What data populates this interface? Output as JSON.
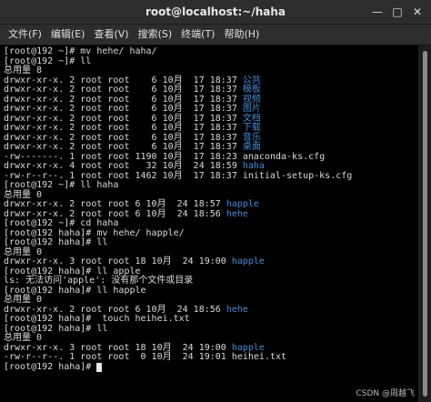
{
  "window": {
    "title": "root@localhost:~/haha",
    "controls": {
      "minimize": "—",
      "maximize": "□",
      "close": "✕"
    }
  },
  "menu": [
    "文件(F)",
    "编辑(E)",
    "查看(V)",
    "搜索(S)",
    "终端(T)",
    "帮助(H)"
  ],
  "terminal_lines": [
    [
      {
        "t": "[root@192 ~]# mv hehe/ haha/"
      }
    ],
    [
      {
        "t": "[root@192 ~]# ll"
      }
    ],
    [
      {
        "t": "总用量 8"
      }
    ],
    [
      {
        "t": "drwxr-xr-x. 2 root root    6 10月  17 18:37 "
      },
      {
        "t": "公共",
        "c": "blue"
      }
    ],
    [
      {
        "t": "drwxr-xr-x. 2 root root    6 10月  17 18:37 "
      },
      {
        "t": "模板",
        "c": "blue"
      }
    ],
    [
      {
        "t": "drwxr-xr-x. 2 root root    6 10月  17 18:37 "
      },
      {
        "t": "视频",
        "c": "blue"
      }
    ],
    [
      {
        "t": "drwxr-xr-x. 2 root root    6 10月  17 18:37 "
      },
      {
        "t": "图片",
        "c": "blue"
      }
    ],
    [
      {
        "t": "drwxr-xr-x. 2 root root    6 10月  17 18:37 "
      },
      {
        "t": "文档",
        "c": "blue"
      }
    ],
    [
      {
        "t": "drwxr-xr-x. 2 root root    6 10月  17 18:37 "
      },
      {
        "t": "下载",
        "c": "blue"
      }
    ],
    [
      {
        "t": "drwxr-xr-x. 2 root root    6 10月  17 18:37 "
      },
      {
        "t": "音乐",
        "c": "blue"
      }
    ],
    [
      {
        "t": "drwxr-xr-x. 2 root root    6 10月  17 18:37 "
      },
      {
        "t": "桌面",
        "c": "blue"
      }
    ],
    [
      {
        "t": "-rw-------. 1 root root 1190 10月  17 18:23 anaconda-ks.cfg"
      }
    ],
    [
      {
        "t": "drwxr-xr-x. 4 root root   32 10月  24 18:59 "
      },
      {
        "t": "haha",
        "c": "blue"
      }
    ],
    [
      {
        "t": "-rw-r--r--. 1 root root 1462 10月  17 18:37 initial-setup-ks.cfg"
      }
    ],
    [
      {
        "t": "[root@192 ~]# ll haha"
      }
    ],
    [
      {
        "t": "总用量 0"
      }
    ],
    [
      {
        "t": "drwxr-xr-x. 2 root root 6 10月  24 18:57 "
      },
      {
        "t": "happle",
        "c": "blue"
      }
    ],
    [
      {
        "t": "drwxr-xr-x. 2 root root 6 10月  24 18:56 "
      },
      {
        "t": "hehe",
        "c": "blue"
      }
    ],
    [
      {
        "t": "[root@192 ~]# cd haha"
      }
    ],
    [
      {
        "t": "[root@192 haha]# mv hehe/ happle/"
      }
    ],
    [
      {
        "t": "[root@192 haha]# ll"
      }
    ],
    [
      {
        "t": "总用量 0"
      }
    ],
    [
      {
        "t": "drwxr-xr-x. 3 root root 18 10月  24 19:00 "
      },
      {
        "t": "happle",
        "c": "blue"
      }
    ],
    [
      {
        "t": "[root@192 haha]# ll apple"
      }
    ],
    [
      {
        "t": "ls: 无法访问'apple': 没有那个文件或目录"
      }
    ],
    [
      {
        "t": "[root@192 haha]# ll happle"
      }
    ],
    [
      {
        "t": "总用量 0"
      }
    ],
    [
      {
        "t": "drwxr-xr-x. 2 root root 6 10月  24 18:56 "
      },
      {
        "t": "hehe",
        "c": "blue"
      }
    ],
    [
      {
        "t": "[root@192 haha]#  touch heihei.txt"
      }
    ],
    [
      {
        "t": "[root@192 haha]# ll"
      }
    ],
    [
      {
        "t": "总用量 0"
      }
    ],
    [
      {
        "t": "drwxr-xr-x. 3 root root 18 10月  24 19:00 "
      },
      {
        "t": "happle",
        "c": "blue"
      }
    ],
    [
      {
        "t": "-rw-r--r--. 1 root root  0 10月  24 19:01 heihei.txt"
      }
    ],
    [
      {
        "t": "[root@192 haha]# "
      },
      {
        "cursor": true
      }
    ]
  ],
  "watermark": "CSDN @周越飞",
  "colors": {
    "background": "#000000",
    "text": "#dcdcdc",
    "directory": "#3f8ed8",
    "titlebar": "#2d2d2d"
  }
}
